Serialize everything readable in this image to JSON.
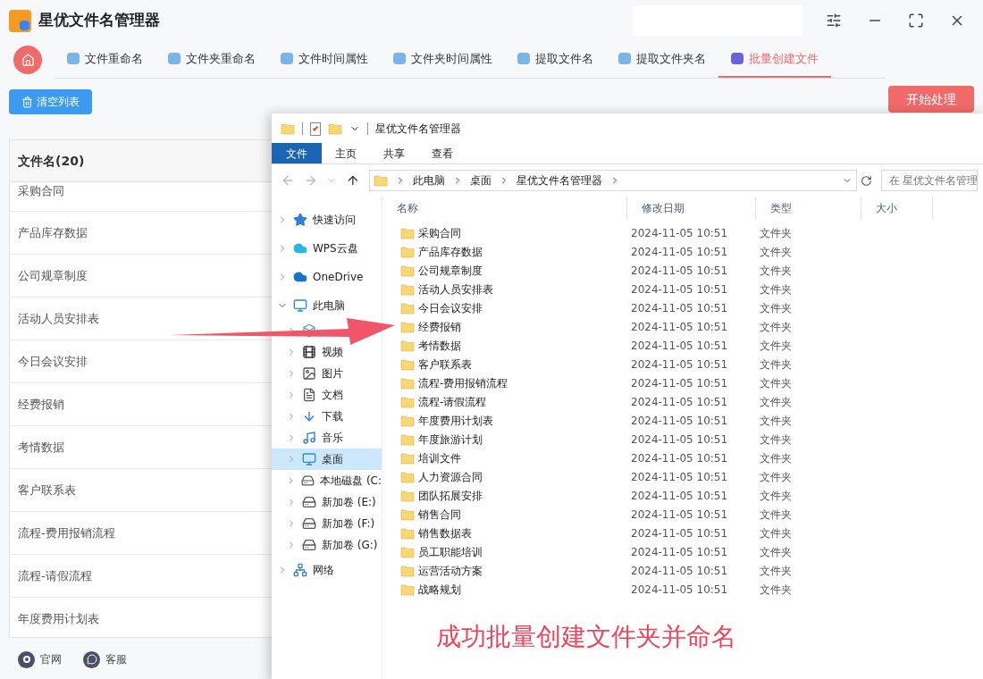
{
  "app": {
    "title": "星优文件名管理器",
    "tabs": [
      {
        "label": "文件重命名",
        "selected": false
      },
      {
        "label": "文件夹重命名",
        "selected": false
      },
      {
        "label": "文件时间属性",
        "selected": false
      },
      {
        "label": "文件夹时间属性",
        "selected": false
      },
      {
        "label": "提取文件名",
        "selected": false
      },
      {
        "label": "提取文件夹名",
        "selected": false
      },
      {
        "label": "批量创建文件",
        "selected": true
      }
    ],
    "clear_button": "清空列表",
    "start_button": "开始处理",
    "table": {
      "header": "文件名(20)",
      "rows": [
        "采购合同",
        "产品库存数据",
        "公司规章制度",
        "活动人员安排表",
        "今日会议安排",
        "经费报销",
        "考情数据",
        "客户联系表",
        "流程-费用报销流程",
        "流程-请假流程",
        "年度费用计划表"
      ]
    },
    "footer": [
      "官网",
      "客服"
    ]
  },
  "explorer": {
    "title": "星优文件名管理器",
    "ribbon_tabs": [
      {
        "label": "文件",
        "selected": true
      },
      {
        "label": "主页",
        "selected": false
      },
      {
        "label": "共享",
        "selected": false
      },
      {
        "label": "查看",
        "selected": false
      }
    ],
    "path": [
      "此电脑",
      "桌面",
      "星优文件名管理器"
    ],
    "search_placeholder": "在 星优文件名管理",
    "nav": [
      {
        "label": "快速访问",
        "kind": "star",
        "expanded": false,
        "selected": false
      },
      {
        "label": "WPS云盘",
        "kind": "cloud",
        "expanded": false,
        "selected": false
      },
      {
        "label": "OneDrive",
        "kind": "onedrive",
        "expanded": false,
        "selected": false
      },
      {
        "label": "此电脑",
        "kind": "pc",
        "expanded": true,
        "selected": false,
        "children": [
          {
            "kind": "objects",
            "selected": false
          },
          {
            "label": "视频",
            "kind": "video",
            "selected": false
          },
          {
            "label": "图片",
            "kind": "image",
            "selected": false
          },
          {
            "label": "文档",
            "kind": "doc",
            "selected": false
          },
          {
            "label": "下载",
            "kind": "download",
            "selected": false
          },
          {
            "label": "音乐",
            "kind": "music",
            "selected": false
          },
          {
            "label": "桌面",
            "kind": "desktop",
            "selected": true
          },
          {
            "label": "本地磁盘 (C:",
            "kind": "sysdrive",
            "selected": false
          },
          {
            "label": "新加卷 (E:)",
            "kind": "drive",
            "selected": false
          },
          {
            "label": "新加卷 (F:)",
            "kind": "drive",
            "selected": false
          },
          {
            "label": "新加卷 (G:)",
            "kind": "drive",
            "selected": false
          }
        ]
      },
      {
        "label": "网络",
        "kind": "network",
        "expanded": false,
        "selected": false
      }
    ],
    "columns": [
      "名称",
      "修改日期",
      "类型",
      "大小"
    ],
    "files": [
      {
        "name": "采购合同",
        "date": "2024-11-05 10:51",
        "type": "文件夹"
      },
      {
        "name": "产品库存数据",
        "date": "2024-11-05 10:51",
        "type": "文件夹"
      },
      {
        "name": "公司规章制度",
        "date": "2024-11-05 10:51",
        "type": "文件夹"
      },
      {
        "name": "活动人员安排表",
        "date": "2024-11-05 10:51",
        "type": "文件夹"
      },
      {
        "name": "今日会议安排",
        "date": "2024-11-05 10:51",
        "type": "文件夹"
      },
      {
        "name": "经费报销",
        "date": "2024-11-05 10:51",
        "type": "文件夹"
      },
      {
        "name": "考情数据",
        "date": "2024-11-05 10:51",
        "type": "文件夹"
      },
      {
        "name": "客户联系表",
        "date": "2024-11-05 10:51",
        "type": "文件夹"
      },
      {
        "name": "流程-费用报销流程",
        "date": "2024-11-05 10:51",
        "type": "文件夹"
      },
      {
        "name": "流程-请假流程",
        "date": "2024-11-05 10:51",
        "type": "文件夹"
      },
      {
        "name": "年度费用计划表",
        "date": "2024-11-05 10:51",
        "type": "文件夹"
      },
      {
        "name": "年度旅游计划",
        "date": "2024-11-05 10:51",
        "type": "文件夹"
      },
      {
        "name": "培训文件",
        "date": "2024-11-05 10:51",
        "type": "文件夹"
      },
      {
        "name": "人力资源合同",
        "date": "2024-11-05 10:51",
        "type": "文件夹"
      },
      {
        "name": "团队拓展安排",
        "date": "2024-11-05 10:51",
        "type": "文件夹"
      },
      {
        "name": "销售合同",
        "date": "2024-11-05 10:51",
        "type": "文件夹"
      },
      {
        "name": "销售数据表",
        "date": "2024-11-05 10:51",
        "type": "文件夹"
      },
      {
        "name": "员工职能培训",
        "date": "2024-11-05 10:51",
        "type": "文件夹"
      },
      {
        "name": "运营活动方案",
        "date": "2024-11-05 10:51",
        "type": "文件夹"
      },
      {
        "name": "战略规划",
        "date": "2024-11-05 10:51",
        "type": "文件夹"
      }
    ]
  },
  "caption": "成功批量创建文件夹并命名"
}
